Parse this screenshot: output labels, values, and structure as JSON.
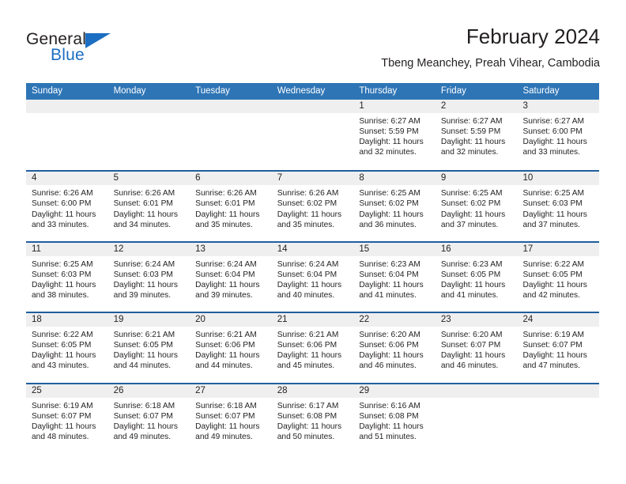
{
  "brand": {
    "name_part1": "General",
    "name_part2": "Blue",
    "accent_color": "#1b6ec2"
  },
  "header": {
    "title": "February 2024",
    "subtitle": "Tbeng Meanchey, Preah Vihear, Cambodia"
  },
  "calendar": {
    "header_color": "#2e75b6",
    "divider_color": "#1f5fa0",
    "day_band_color": "#efefef",
    "weekdays": [
      "Sunday",
      "Monday",
      "Tuesday",
      "Wednesday",
      "Thursday",
      "Friday",
      "Saturday"
    ],
    "weeks": [
      [
        {
          "day": "",
          "lines": []
        },
        {
          "day": "",
          "lines": []
        },
        {
          "day": "",
          "lines": []
        },
        {
          "day": "",
          "lines": []
        },
        {
          "day": "1",
          "lines": [
            "Sunrise: 6:27 AM",
            "Sunset: 5:59 PM",
            "Daylight: 11 hours",
            "and 32 minutes."
          ]
        },
        {
          "day": "2",
          "lines": [
            "Sunrise: 6:27 AM",
            "Sunset: 5:59 PM",
            "Daylight: 11 hours",
            "and 32 minutes."
          ]
        },
        {
          "day": "3",
          "lines": [
            "Sunrise: 6:27 AM",
            "Sunset: 6:00 PM",
            "Daylight: 11 hours",
            "and 33 minutes."
          ]
        }
      ],
      [
        {
          "day": "4",
          "lines": [
            "Sunrise: 6:26 AM",
            "Sunset: 6:00 PM",
            "Daylight: 11 hours",
            "and 33 minutes."
          ]
        },
        {
          "day": "5",
          "lines": [
            "Sunrise: 6:26 AM",
            "Sunset: 6:01 PM",
            "Daylight: 11 hours",
            "and 34 minutes."
          ]
        },
        {
          "day": "6",
          "lines": [
            "Sunrise: 6:26 AM",
            "Sunset: 6:01 PM",
            "Daylight: 11 hours",
            "and 35 minutes."
          ]
        },
        {
          "day": "7",
          "lines": [
            "Sunrise: 6:26 AM",
            "Sunset: 6:02 PM",
            "Daylight: 11 hours",
            "and 35 minutes."
          ]
        },
        {
          "day": "8",
          "lines": [
            "Sunrise: 6:25 AM",
            "Sunset: 6:02 PM",
            "Daylight: 11 hours",
            "and 36 minutes."
          ]
        },
        {
          "day": "9",
          "lines": [
            "Sunrise: 6:25 AM",
            "Sunset: 6:02 PM",
            "Daylight: 11 hours",
            "and 37 minutes."
          ]
        },
        {
          "day": "10",
          "lines": [
            "Sunrise: 6:25 AM",
            "Sunset: 6:03 PM",
            "Daylight: 11 hours",
            "and 37 minutes."
          ]
        }
      ],
      [
        {
          "day": "11",
          "lines": [
            "Sunrise: 6:25 AM",
            "Sunset: 6:03 PM",
            "Daylight: 11 hours",
            "and 38 minutes."
          ]
        },
        {
          "day": "12",
          "lines": [
            "Sunrise: 6:24 AM",
            "Sunset: 6:03 PM",
            "Daylight: 11 hours",
            "and 39 minutes."
          ]
        },
        {
          "day": "13",
          "lines": [
            "Sunrise: 6:24 AM",
            "Sunset: 6:04 PM",
            "Daylight: 11 hours",
            "and 39 minutes."
          ]
        },
        {
          "day": "14",
          "lines": [
            "Sunrise: 6:24 AM",
            "Sunset: 6:04 PM",
            "Daylight: 11 hours",
            "and 40 minutes."
          ]
        },
        {
          "day": "15",
          "lines": [
            "Sunrise: 6:23 AM",
            "Sunset: 6:04 PM",
            "Daylight: 11 hours",
            "and 41 minutes."
          ]
        },
        {
          "day": "16",
          "lines": [
            "Sunrise: 6:23 AM",
            "Sunset: 6:05 PM",
            "Daylight: 11 hours",
            "and 41 minutes."
          ]
        },
        {
          "day": "17",
          "lines": [
            "Sunrise: 6:22 AM",
            "Sunset: 6:05 PM",
            "Daylight: 11 hours",
            "and 42 minutes."
          ]
        }
      ],
      [
        {
          "day": "18",
          "lines": [
            "Sunrise: 6:22 AM",
            "Sunset: 6:05 PM",
            "Daylight: 11 hours",
            "and 43 minutes."
          ]
        },
        {
          "day": "19",
          "lines": [
            "Sunrise: 6:21 AM",
            "Sunset: 6:05 PM",
            "Daylight: 11 hours",
            "and 44 minutes."
          ]
        },
        {
          "day": "20",
          "lines": [
            "Sunrise: 6:21 AM",
            "Sunset: 6:06 PM",
            "Daylight: 11 hours",
            "and 44 minutes."
          ]
        },
        {
          "day": "21",
          "lines": [
            "Sunrise: 6:21 AM",
            "Sunset: 6:06 PM",
            "Daylight: 11 hours",
            "and 45 minutes."
          ]
        },
        {
          "day": "22",
          "lines": [
            "Sunrise: 6:20 AM",
            "Sunset: 6:06 PM",
            "Daylight: 11 hours",
            "and 46 minutes."
          ]
        },
        {
          "day": "23",
          "lines": [
            "Sunrise: 6:20 AM",
            "Sunset: 6:07 PM",
            "Daylight: 11 hours",
            "and 46 minutes."
          ]
        },
        {
          "day": "24",
          "lines": [
            "Sunrise: 6:19 AM",
            "Sunset: 6:07 PM",
            "Daylight: 11 hours",
            "and 47 minutes."
          ]
        }
      ],
      [
        {
          "day": "25",
          "lines": [
            "Sunrise: 6:19 AM",
            "Sunset: 6:07 PM",
            "Daylight: 11 hours",
            "and 48 minutes."
          ]
        },
        {
          "day": "26",
          "lines": [
            "Sunrise: 6:18 AM",
            "Sunset: 6:07 PM",
            "Daylight: 11 hours",
            "and 49 minutes."
          ]
        },
        {
          "day": "27",
          "lines": [
            "Sunrise: 6:18 AM",
            "Sunset: 6:07 PM",
            "Daylight: 11 hours",
            "and 49 minutes."
          ]
        },
        {
          "day": "28",
          "lines": [
            "Sunrise: 6:17 AM",
            "Sunset: 6:08 PM",
            "Daylight: 11 hours",
            "and 50 minutes."
          ]
        },
        {
          "day": "29",
          "lines": [
            "Sunrise: 6:16 AM",
            "Sunset: 6:08 PM",
            "Daylight: 11 hours",
            "and 51 minutes."
          ]
        },
        {
          "day": "",
          "lines": []
        },
        {
          "day": "",
          "lines": []
        }
      ]
    ]
  }
}
